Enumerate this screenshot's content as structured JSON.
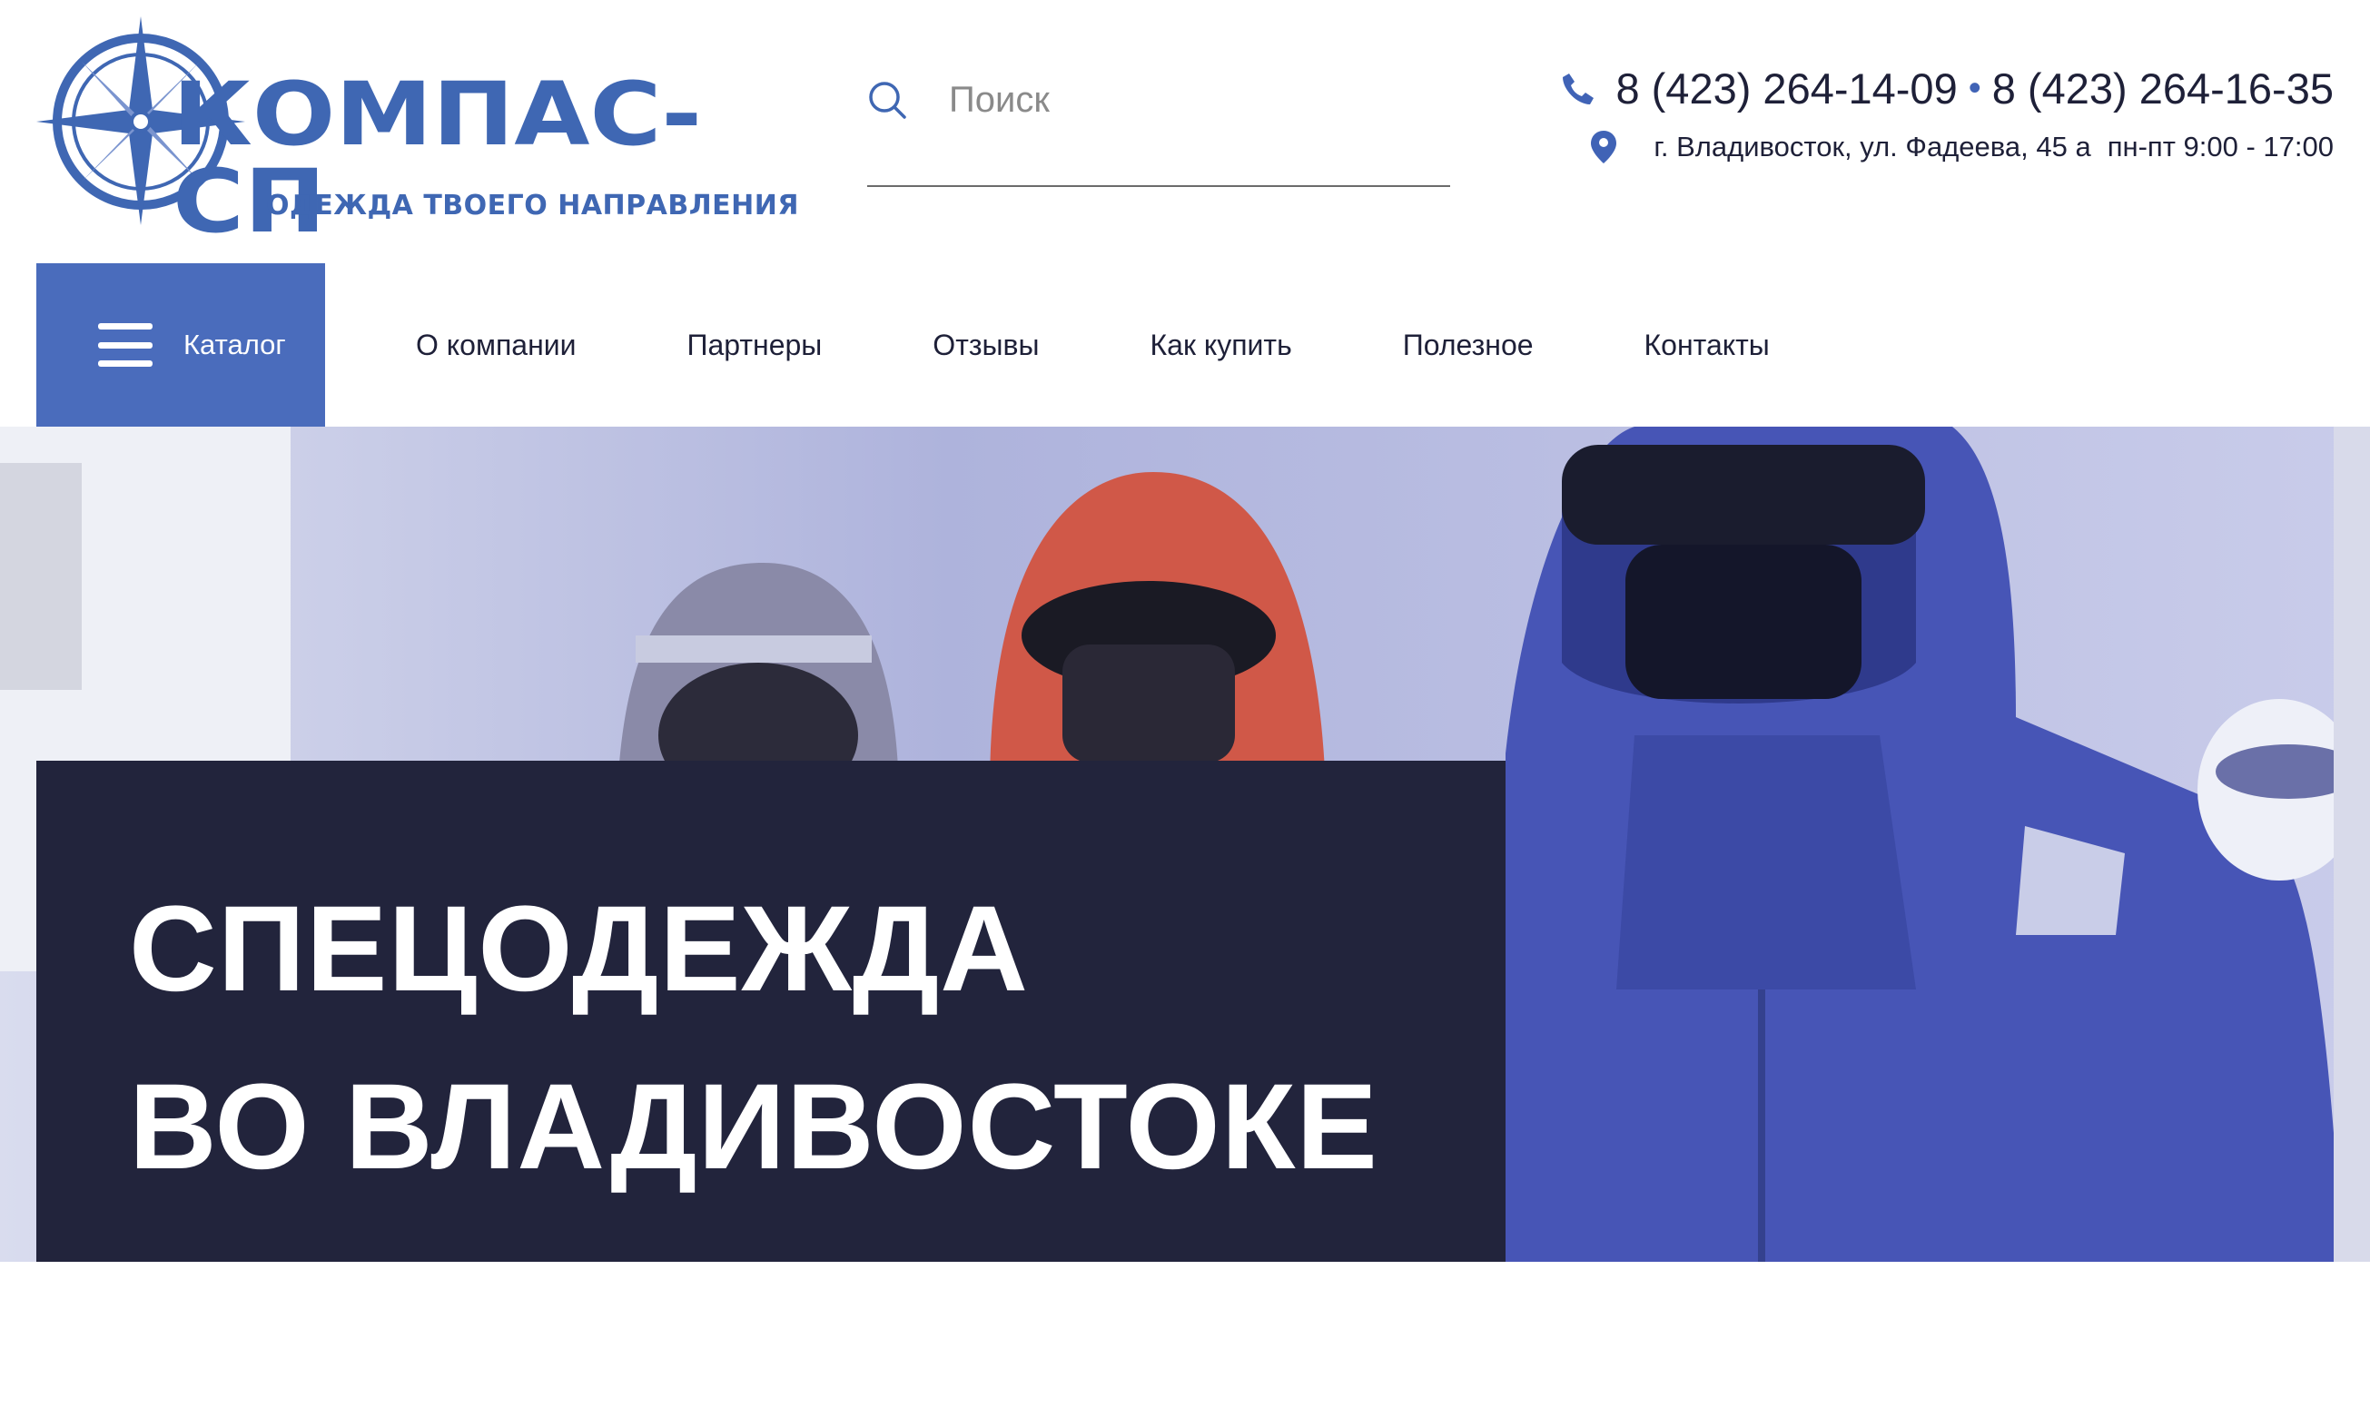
{
  "header": {
    "logo": {
      "name": "КОМПАС-СП",
      "tagline": "ОДЕЖДА ТВОЕГО НАПРАВЛЕНИЯ"
    },
    "search": {
      "placeholder": "Поиск",
      "value": ""
    },
    "contacts": {
      "phone_1": "8 (423) 264-14-09",
      "separator": "•",
      "phone_2": "8 (423) 264-16-35",
      "address": "г. Владивосток, ул. Фадеева, 45 а",
      "hours": "пн-пт 9:00 - 17:00"
    }
  },
  "nav": {
    "catalog_label": "Каталог",
    "links": [
      "О компании",
      "Партнеры",
      "Отзывы",
      "Как купить",
      "Полезное",
      "Контакты"
    ]
  },
  "hero": {
    "title_line_1": "СПЕЦОДЕЖДА",
    "title_line_2": "ВО ВЛАДИВОСТОКЕ"
  },
  "icons": {
    "logo": "compass-rose-icon",
    "search": "search-icon",
    "phone": "phone-icon",
    "location": "map-pin-icon",
    "menu": "menu-icon"
  },
  "colors": {
    "brand_blue": "#3f67b3",
    "catalog_button": "#4a6cbc",
    "hero_box": "#22243c",
    "text": "#1e2038",
    "hero_photo_tint": "#4755b6"
  }
}
